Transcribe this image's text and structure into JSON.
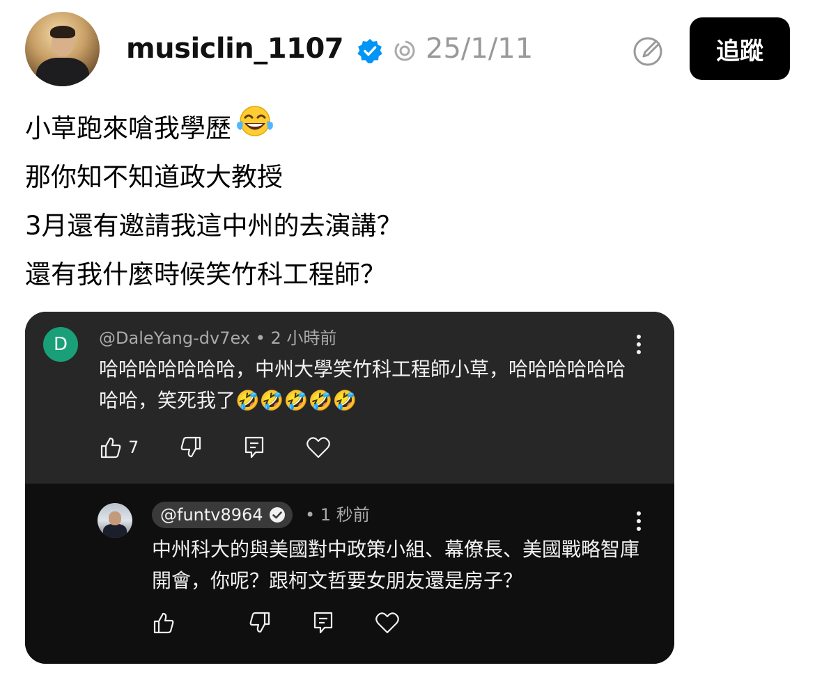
{
  "post": {
    "username": "musiclin_1107",
    "date": "25/1/11",
    "follow_label": "追蹤",
    "lines": [
      "小草跑來嗆我學歷",
      "那你知不知道政大教授",
      "3月還有邀請我這中州的去演講？",
      "還有我什麼時候笑竹科工程師？"
    ],
    "line1_emoji": "😂"
  },
  "comment": {
    "avatar_letter": "D",
    "handle": "@DaleYang-dv7ex",
    "separator": "•",
    "time": "2 小時前",
    "text": "哈哈哈哈哈哈哈，中州大學笑竹科工程師小草，哈哈哈哈哈哈哈哈，笑死我了🤣🤣🤣🤣🤣",
    "like_count": "7"
  },
  "reply": {
    "handle": "@funtv8964",
    "separator": "•",
    "time": "1 秒前",
    "text": "中州科大的與美國對中政策小組、幕僚長、美國戰略智庫開會，你呢？跟柯文哲要女朋友還是房子？"
  },
  "icons": {
    "verified": "verified-badge-icon",
    "thread": "threads-activity-icon",
    "edit": "compose-icon",
    "more": "more-vertical-icon",
    "like": "thumb-up-icon",
    "dislike": "thumb-down-icon",
    "reply": "reply-icon",
    "heart": "heart-icon"
  },
  "colors": {
    "verified": "#0095f6",
    "comment_bg": "#272727",
    "reply_bg": "#0f0f0f",
    "avatar_d": "#1aa079"
  }
}
